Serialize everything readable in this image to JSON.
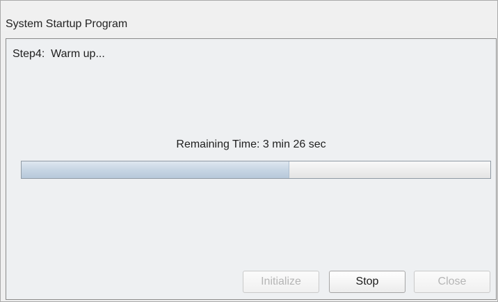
{
  "window": {
    "title": "System Startup Program"
  },
  "step": {
    "text": "Step4:  Warm up..."
  },
  "progress": {
    "remaining_text": "Remaining Time: 3 min 26 sec",
    "value_percent": 57
  },
  "buttons": {
    "initialize": {
      "label": "Initialize",
      "enabled": false
    },
    "stop": {
      "label": "Stop",
      "enabled": true
    },
    "close": {
      "label": "Close",
      "enabled": false
    }
  }
}
